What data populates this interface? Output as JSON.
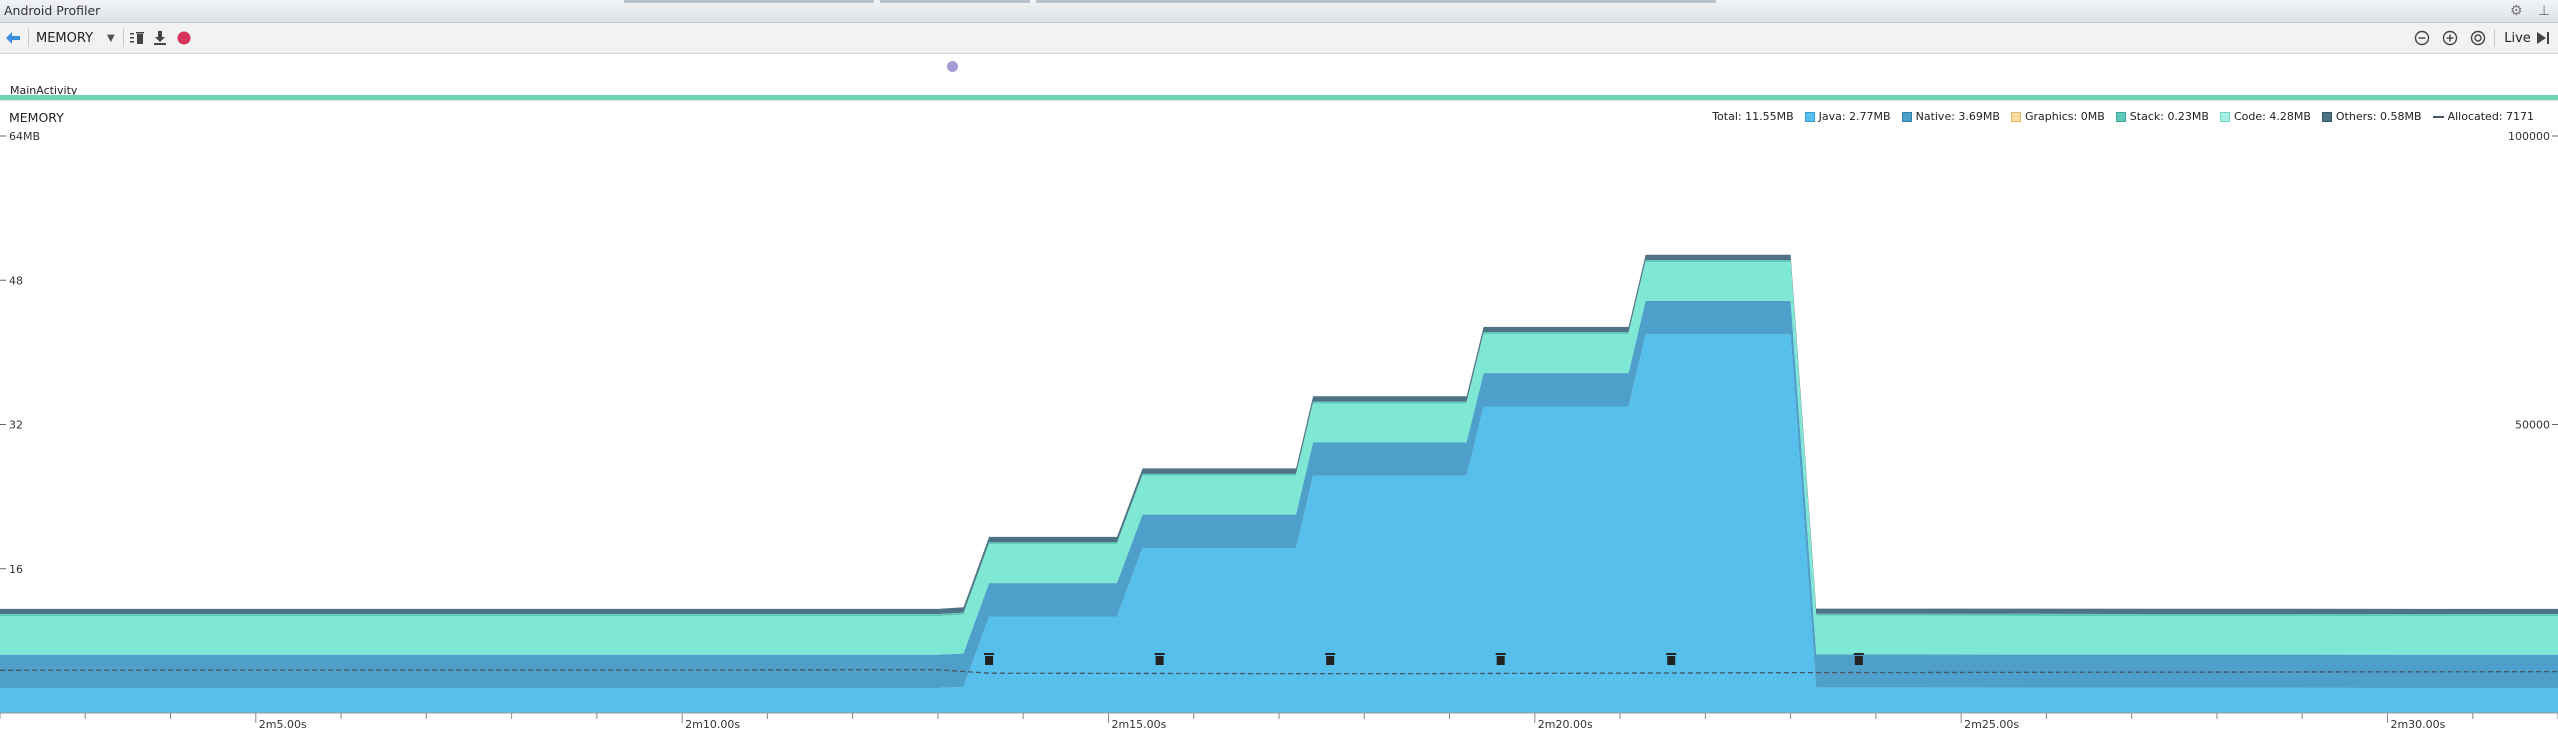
{
  "window": {
    "title": "Android Profiler"
  },
  "toolbar": {
    "back_icon": "back-arrow-icon",
    "profiler_select": "MEMORY",
    "gc_icon": "garbage-collect-icon",
    "dump_icon": "heap-dump-icon",
    "record_icon": "record-allocations-icon",
    "zoom_out_icon": "zoom-out-icon",
    "zoom_in_icon": "zoom-in-icon",
    "reset_zoom_icon": "reset-zoom-icon",
    "live_label": "Live",
    "live_icon": "go-live-icon"
  },
  "activity": {
    "label": "MainActivity"
  },
  "chart": {
    "title": "MEMORY",
    "left_axis": {
      "labels": [
        "64MB",
        "48",
        "32",
        "16"
      ]
    },
    "right_axis": {
      "labels": [
        "100000",
        "50000"
      ]
    },
    "time_labels": [
      "2m5.00s",
      "2m10.00s",
      "2m15.00s",
      "2m20.00s",
      "2m25.00s",
      "2m30.00s"
    ]
  },
  "legend": {
    "total": "Total: 11.55MB",
    "java": "Java: 2.77MB",
    "native": "Native: 3.69MB",
    "graphics": "Graphics: 0MB",
    "stack": "Stack: 0.23MB",
    "code": "Code: 4.28MB",
    "others": "Others: 0.58MB",
    "allocated": "Allocated: 7171"
  },
  "colors": {
    "java": "#56bfeb",
    "native": "#4e9fc9",
    "graphics": "#f9dc9e",
    "stack": "#5ccab8",
    "code": "#7ee8d5",
    "others": "#4f7386",
    "allocated_line": "#445566",
    "activity": "#6dd5b4"
  },
  "chart_data": {
    "type": "area",
    "x_unit": "seconds",
    "x_range": [
      2.0,
      32.0
    ],
    "y_unit": "MB",
    "ylim": [
      0,
      64
    ],
    "y2_lim": [
      0,
      100000
    ],
    "points": [
      {
        "t": 2.0,
        "java": 2.77,
        "native": 3.69,
        "code": 4.28,
        "stack": 0.23,
        "others": 0.58
      },
      {
        "t": 13.0,
        "java": 2.77,
        "native": 3.69,
        "code": 4.28,
        "stack": 0.23,
        "others": 0.58
      },
      {
        "t": 13.3,
        "java": 2.9,
        "native": 3.7,
        "code": 4.3,
        "stack": 0.23,
        "others": 0.6
      },
      {
        "t": 13.6,
        "java": 10.7,
        "native": 3.7,
        "code": 4.3,
        "stack": 0.23,
        "others": 0.6
      },
      {
        "t": 15.1,
        "java": 10.7,
        "native": 3.7,
        "code": 4.3,
        "stack": 0.23,
        "others": 0.6
      },
      {
        "t": 15.4,
        "java": 18.3,
        "native": 3.7,
        "code": 4.3,
        "stack": 0.23,
        "others": 0.6
      },
      {
        "t": 17.2,
        "java": 18.3,
        "native": 3.7,
        "code": 4.3,
        "stack": 0.23,
        "others": 0.6
      },
      {
        "t": 17.4,
        "java": 26.3,
        "native": 3.7,
        "code": 4.3,
        "stack": 0.23,
        "others": 0.6
      },
      {
        "t": 19.2,
        "java": 26.3,
        "native": 3.7,
        "code": 4.3,
        "stack": 0.23,
        "others": 0.6
      },
      {
        "t": 19.4,
        "java": 34.0,
        "native": 3.7,
        "code": 4.3,
        "stack": 0.23,
        "others": 0.6
      },
      {
        "t": 21.1,
        "java": 34.0,
        "native": 3.7,
        "code": 4.3,
        "stack": 0.23,
        "others": 0.6
      },
      {
        "t": 21.3,
        "java": 42.0,
        "native": 3.7,
        "code": 4.3,
        "stack": 0.23,
        "others": 0.6
      },
      {
        "t": 23.0,
        "java": 42.0,
        "native": 3.7,
        "code": 4.3,
        "stack": 0.23,
        "others": 0.6
      },
      {
        "t": 23.3,
        "java": 2.8,
        "native": 3.69,
        "code": 4.28,
        "stack": 0.23,
        "others": 0.58
      },
      {
        "t": 32.0,
        "java": 2.77,
        "native": 3.69,
        "code": 4.28,
        "stack": 0.23,
        "others": 0.58
      }
    ],
    "allocated": [
      {
        "t": 2.0,
        "v": 7400
      },
      {
        "t": 13.0,
        "v": 7500
      },
      {
        "t": 13.6,
        "v": 6900
      },
      {
        "t": 18.0,
        "v": 6800
      },
      {
        "t": 23.3,
        "v": 7000
      },
      {
        "t": 32.0,
        "v": 7171
      }
    ],
    "gc_events": [
      13.6,
      15.6,
      17.6,
      19.6,
      21.6,
      23.8
    ]
  }
}
